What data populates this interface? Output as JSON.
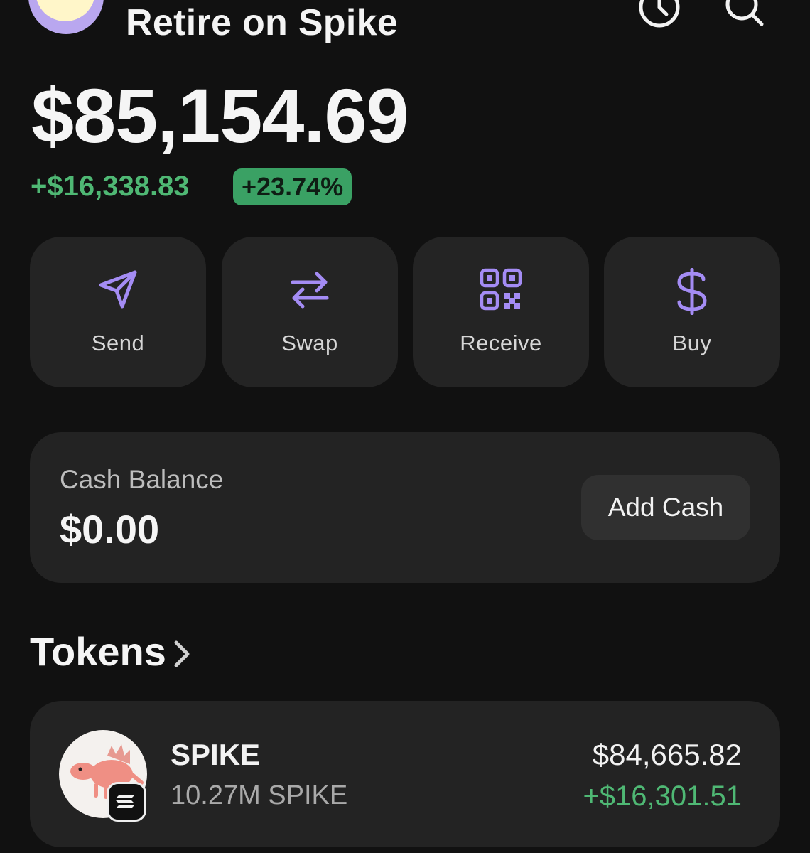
{
  "header": {
    "title": "Retire on Spike",
    "history_icon": "history-icon",
    "search_icon": "search-icon"
  },
  "balance": {
    "total": "$85,154.69",
    "change": "+$16,338.83",
    "change_pct": "+23.74%"
  },
  "actions": [
    {
      "label": "Send",
      "icon": "send-icon"
    },
    {
      "label": "Swap",
      "icon": "swap-icon"
    },
    {
      "label": "Receive",
      "icon": "qr-code-icon"
    },
    {
      "label": "Buy",
      "icon": "dollar-icon"
    }
  ],
  "cash": {
    "label": "Cash Balance",
    "value": "$0.00",
    "button_label": "Add Cash"
  },
  "tokens": {
    "title": "Tokens",
    "items": [
      {
        "name": "SPIKE",
        "amount": "10.27M SPIKE",
        "value": "$84,665.82",
        "change": "+$16,301.51"
      }
    ]
  },
  "colors": {
    "background": "#111111",
    "card": "#232323",
    "accent_purple": "#a48cf4",
    "positive_green": "#4fb874"
  }
}
